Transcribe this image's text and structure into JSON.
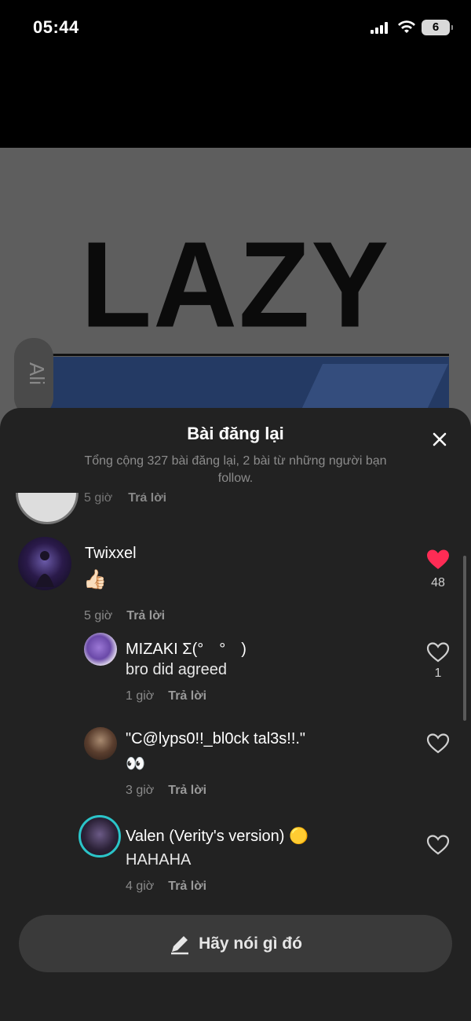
{
  "status_bar": {
    "time": "05:44",
    "battery": "6"
  },
  "background_video": {
    "title_text": "LAZY",
    "side_text": "Ali"
  },
  "sheet": {
    "title": "Bài đăng lại",
    "subtitle": "Tổng cộng 327 bài đăng lại, 2 bài từ những người bạn follow."
  },
  "partial_comment": {
    "time": "5 giờ",
    "reply": "Trả lời"
  },
  "comments": [
    {
      "name": "Twixxel",
      "text": "👍🏻",
      "time": "5 giờ",
      "reply": "Trả lời",
      "likes": "48",
      "liked": true
    },
    {
      "name": "MIZAKI Σ(°　°　)",
      "text": "bro did agreed",
      "time": "1 giờ",
      "reply": "Trả lời",
      "likes": "1",
      "liked": false
    },
    {
      "name": "\"C@lyps0!!_bl0ck tal3s!!.\"",
      "text": "👀",
      "time": "3 giờ",
      "reply": "Trả lời",
      "likes": "",
      "liked": false
    },
    {
      "name": "Valen (Verity's version) 🟡",
      "text": "HAHAHA",
      "time": "4 giờ",
      "reply": "Trả lời",
      "likes": "",
      "liked": false
    }
  ],
  "input": {
    "placeholder": "Hãy nói gì đó"
  },
  "colors": {
    "like_active": "#fe2c55",
    "sheet_bg": "#222222",
    "input_bg": "#3a3a3a"
  },
  "icons": [
    "signal-icon",
    "wifi-icon",
    "battery-icon",
    "close-icon",
    "heart-icon",
    "pencil-icon"
  ]
}
